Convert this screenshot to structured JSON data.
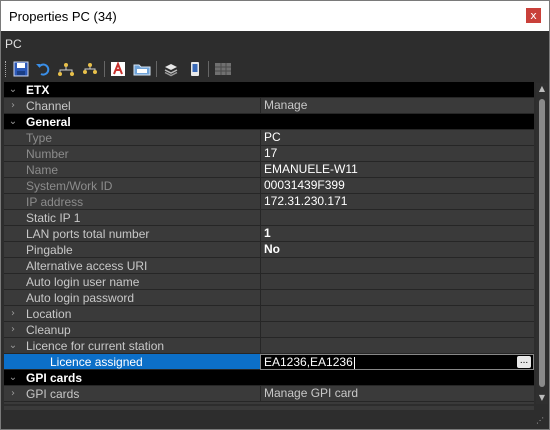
{
  "window": {
    "title": "Properties PC (34)",
    "close_glyph": "x"
  },
  "breadcrumb": "PC",
  "toolbar": [
    {
      "name": "save-icon"
    },
    {
      "name": "undo-icon"
    },
    {
      "name": "network-icon"
    },
    {
      "name": "network-alt-icon"
    },
    {
      "name": "font-icon"
    },
    {
      "name": "folder-icon"
    },
    {
      "name": "stack-icon"
    },
    {
      "name": "device-icon"
    },
    {
      "name": "grid-icon"
    }
  ],
  "rows": [
    {
      "kind": "cat",
      "label": "ETX",
      "expander": "⌄"
    },
    {
      "kind": "prop",
      "label": "Channel",
      "value": "Manage",
      "expander": "›",
      "label_style": "plain",
      "value_style": "plain"
    },
    {
      "kind": "cat",
      "label": "General",
      "expander": "⌄"
    },
    {
      "kind": "prop",
      "label": "Type",
      "value": "PC",
      "label_style": "dim",
      "value_style": "white"
    },
    {
      "kind": "prop",
      "label": "Number",
      "value": "17",
      "label_style": "dim",
      "value_style": "white"
    },
    {
      "kind": "prop",
      "label": "Name",
      "value": "EMANUELE-W11",
      "label_style": "dim",
      "value_style": "white"
    },
    {
      "kind": "prop",
      "label": "System/Work ID",
      "value": "00031439F399",
      "label_style": "dim",
      "value_style": "white"
    },
    {
      "kind": "prop",
      "label": "IP address",
      "value": "172.31.230.171",
      "label_style": "dim",
      "value_style": "white"
    },
    {
      "kind": "prop",
      "label": "Static IP 1",
      "value": "",
      "label_style": "plain",
      "value_style": "white"
    },
    {
      "kind": "prop",
      "label": "LAN ports total number",
      "value": "1",
      "label_style": "plain",
      "value_style": "bold"
    },
    {
      "kind": "prop",
      "label": "Pingable",
      "value": "No",
      "label_style": "plain",
      "value_style": "bold"
    },
    {
      "kind": "prop",
      "label": "Alternative access URI",
      "value": "",
      "label_style": "plain",
      "value_style": "white"
    },
    {
      "kind": "prop",
      "label": "Auto login user name",
      "value": "",
      "label_style": "plain",
      "value_style": "white"
    },
    {
      "kind": "prop",
      "label": "Auto login password",
      "value": "",
      "label_style": "plain",
      "value_style": "white"
    },
    {
      "kind": "prop",
      "label": "Location",
      "value": "",
      "expander": "›",
      "label_style": "plain",
      "value_style": "white"
    },
    {
      "kind": "prop",
      "label": "Cleanup",
      "value": "",
      "expander": "›",
      "label_style": "plain",
      "value_style": "white"
    },
    {
      "kind": "prop",
      "label": "Licence for current station",
      "value": "",
      "expander": "⌄",
      "label_style": "plain",
      "value_style": "white"
    },
    {
      "kind": "sel",
      "label": "Licence assigned",
      "value": "EA1236,EA1236",
      "button": "..."
    },
    {
      "kind": "cat",
      "label": "GPI cards",
      "expander": "⌄"
    },
    {
      "kind": "prop",
      "label": "GPI cards",
      "value": "Manage GPI card",
      "expander": "›",
      "label_style": "plain",
      "value_style": "plain"
    }
  ]
}
